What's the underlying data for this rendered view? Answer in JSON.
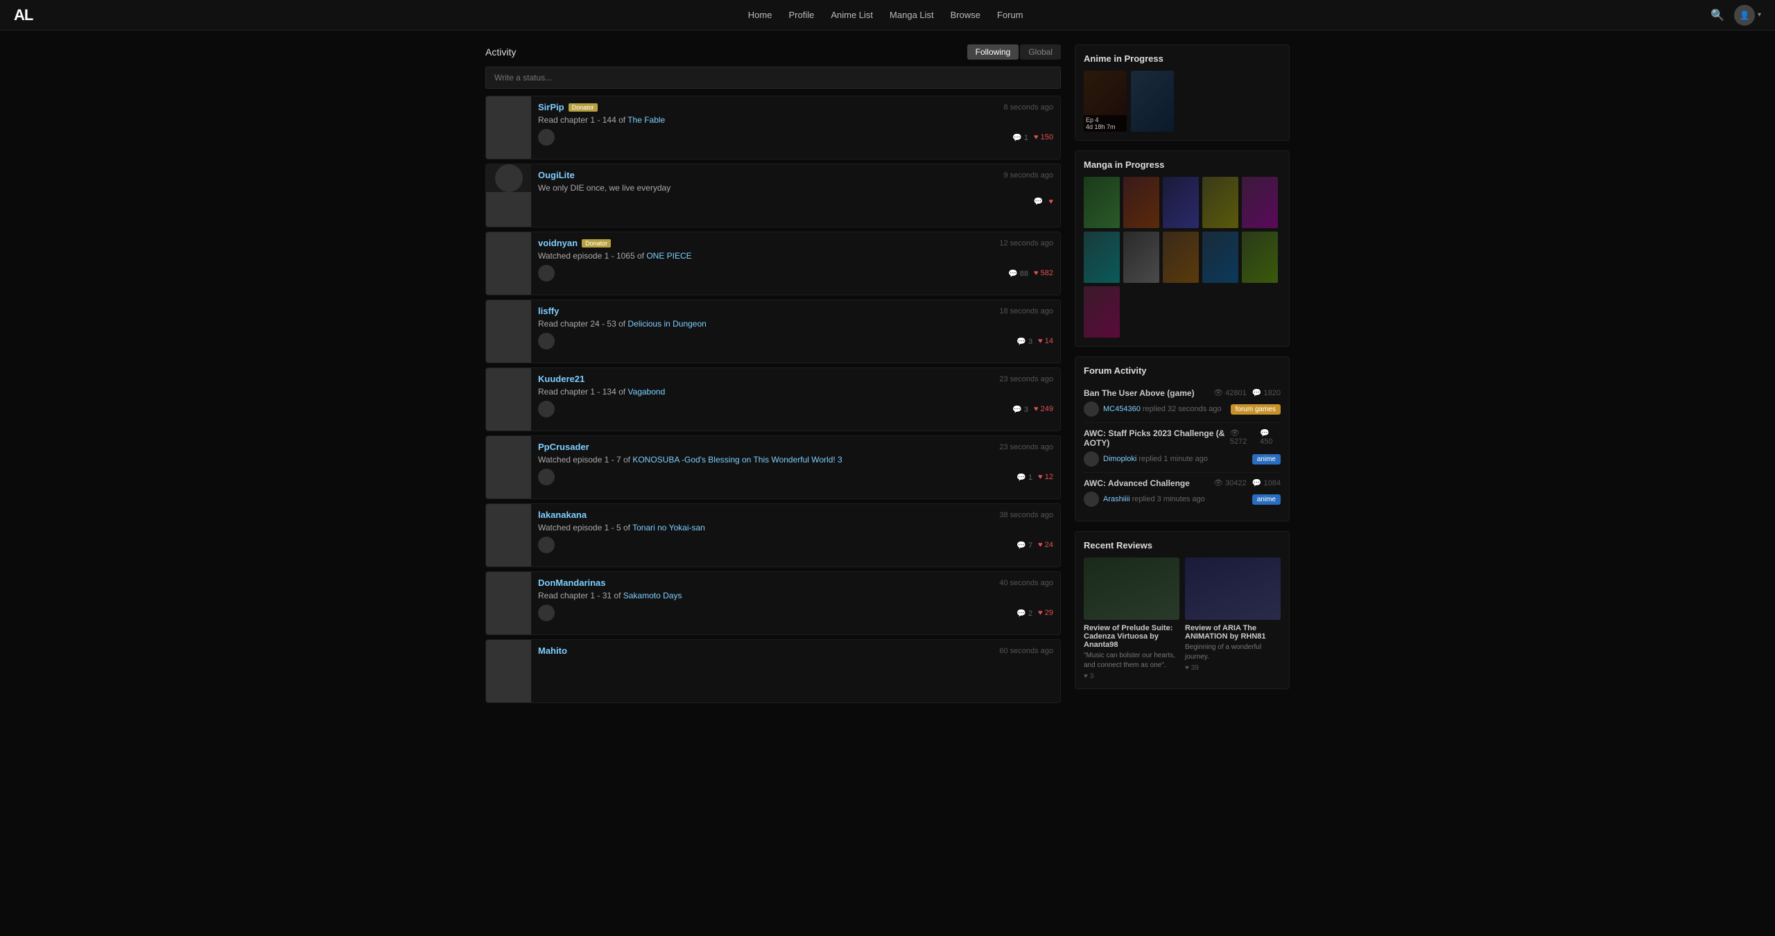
{
  "nav": {
    "logo": "AL",
    "links": [
      "Home",
      "Profile",
      "Anime List",
      "Manga List",
      "Browse",
      "Forum"
    ],
    "search_icon": "🔍"
  },
  "activity": {
    "title": "Activity",
    "tabs": [
      {
        "label": "Following",
        "active": true
      },
      {
        "label": "Global",
        "active": false
      }
    ],
    "status_placeholder": "Write a status...",
    "items": [
      {
        "user": "SirPip",
        "donor": true,
        "time": "8 seconds ago",
        "text": "Read chapter 1 - 144 of ",
        "link_text": "The Fable",
        "comments": "1",
        "likes": "150"
      },
      {
        "user": "OugiLite",
        "donor": false,
        "time": "9 seconds ago",
        "text": "We only DIE once, we live everyday",
        "link_text": "",
        "comments": "",
        "likes": ""
      },
      {
        "user": "voidnyan",
        "donor": true,
        "time": "12 seconds ago",
        "text": "Watched episode 1 - 1065 of ",
        "link_text": "ONE PIECE",
        "comments": "88",
        "likes": "582"
      },
      {
        "user": "lisffy",
        "donor": false,
        "time": "18 seconds ago",
        "text": "Read chapter 24 - 53 of ",
        "link_text": "Delicious in Dungeon",
        "comments": "3",
        "likes": "14"
      },
      {
        "user": "Kuudere21",
        "donor": false,
        "time": "23 seconds ago",
        "text": "Read chapter 1 - 134 of ",
        "link_text": "Vagabond",
        "comments": "3",
        "likes": "249"
      },
      {
        "user": "PpCrusader",
        "donor": false,
        "time": "23 seconds ago",
        "text": "Watched episode 1 - 7 of ",
        "link_text": "KONOSUBA -God's Blessing on This Wonderful World! 3",
        "comments": "1",
        "likes": "12"
      },
      {
        "user": "lakanakana",
        "donor": false,
        "time": "38 seconds ago",
        "text": "Watched episode 1 - 5 of ",
        "link_text": "Tonari no Yokai-san",
        "comments": "7",
        "likes": "24"
      },
      {
        "user": "DonMandarinas",
        "donor": false,
        "time": "40 seconds ago",
        "text": "Read chapter 1 - 31 of ",
        "link_text": "Sakamoto Days",
        "comments": "2",
        "likes": "29"
      },
      {
        "user": "Mahito",
        "donor": false,
        "time": "60 seconds ago",
        "text": "",
        "link_text": "",
        "comments": "",
        "likes": ""
      }
    ]
  },
  "anime_in_progress": {
    "title": "Anime in Progress",
    "items": [
      {
        "ep": "Ep 4",
        "time": "4d 18h 7m"
      },
      {
        "ep": "",
        "time": ""
      }
    ]
  },
  "manga_in_progress": {
    "title": "Manga in Progress",
    "count": 11
  },
  "forum_activity": {
    "title": "Forum Activity",
    "items": [
      {
        "title": "Ban The User Above (game)",
        "views": "42801",
        "replies": "1820",
        "user": "MC454360",
        "reply_text": "replied 32 seconds ago",
        "tag": "forum games",
        "tag_class": "tag-forum"
      },
      {
        "title": "AWC: Staff Picks 2023 Challenge (& AOTY)",
        "views": "5272",
        "replies": "450",
        "user": "Dimoploki",
        "reply_text": "replied 1 minute ago",
        "tag": "anime",
        "tag_class": "tag-anime"
      },
      {
        "title": "AWC: Advanced Challenge",
        "views": "30422",
        "replies": "1084",
        "user": "Arashiiii",
        "reply_text": "replied 3 minutes ago",
        "tag": "anime",
        "tag_class": "tag-anime"
      }
    ]
  },
  "recent_reviews": {
    "title": "Recent Reviews",
    "items": [
      {
        "title": "Review of Prelude Suite: Cadenza Virtuosa by Ananta98",
        "text": "\"Music can bolster our hearts, and connect them as one\".",
        "likes": "3"
      },
      {
        "title": "Review of ARIA The ANIMATION by RHN81",
        "text": "Beginning of a wonderful journey.",
        "likes": "39"
      }
    ]
  }
}
